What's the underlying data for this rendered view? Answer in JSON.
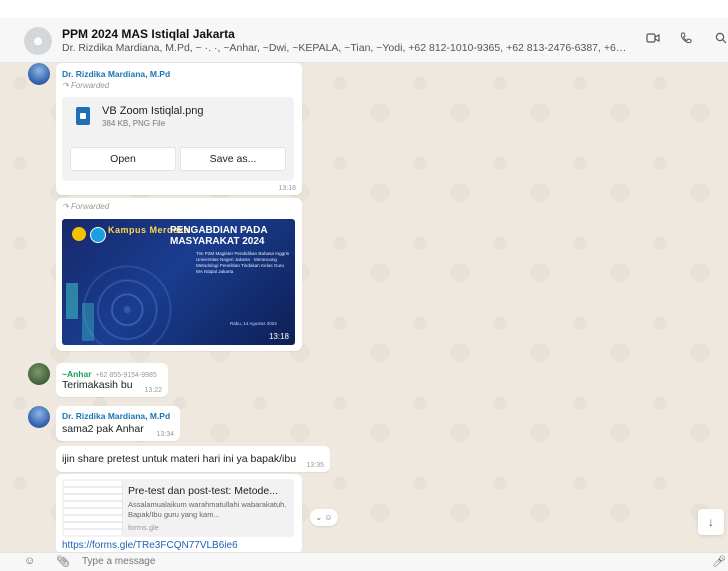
{
  "header": {
    "avatar_icon": "users-group-icon",
    "title": "PPM 2024 MAS Istiqlal Jakarta",
    "subtitle": "Dr. Rizdika Mardiana, M.Pd, ~ ·. ·, ~Anhar, ~Dwi, ~KEPALA, ~Tian, ~Yodi, +62 812-1010-9365, +62 813-2476-6387, +62 8...",
    "video_icon": "video-call-icon",
    "call_icon": "phone-call-icon",
    "search_icon": "search-icon"
  },
  "messages": {
    "m1": {
      "sender": "Dr. Rizdika Mardiana, M.Pd",
      "forwarded": "Forwarded",
      "file_name": "VB Zoom Istiqlal.png",
      "file_meta": "384 KB, PNG File",
      "open_label": "Open",
      "save_label": "Save as...",
      "time": "13:18"
    },
    "m2": {
      "forwarded": "Forwarded",
      "poster_logo": "Kampus Merdeka",
      "poster_title": "PENGABDIAN PADA MASYARAKAT 2024",
      "poster_body": "Tim P2M Magister Pendidikan Bahasa Inggris Universitas Negeri Jakarta · Merancang Metodologi Penelitian Tindakan Kelas Guru MA Istiqlal Jakarta",
      "poster_date": "Rabu, 14 Agustus 2024",
      "time": "13:18"
    },
    "m3": {
      "sender": "~Anhar",
      "phone": "+62 855-9154-9985",
      "text": "Terimakasih bu",
      "time": "13:22"
    },
    "m4": {
      "sender": "Dr. Rizdika Mardiana, M.Pd",
      "text": "sama2 pak Anhar",
      "time": "13:34"
    },
    "m5": {
      "text": "ijin share pretest untuk materi hari ini ya bapak/ibu",
      "time": "13:35"
    },
    "m6": {
      "link_title": "Pre-test dan post-test: Metode...",
      "link_desc": "Assalamualaikum warahmatullahi wabarakatuh. Bapak/Ibu guru yang kam...",
      "link_domain": "forms.gle",
      "url": "https://forms.gle/TRe3FCQN77VLB6ie6"
    }
  },
  "reaction_icon": "emoji-reaction-icon",
  "scroll_down_icon": "arrow-down-icon",
  "composer": {
    "emoji_icon": "emoji-icon",
    "attach_icon": "paperclip-icon",
    "placeholder": "Type a message",
    "mic_icon": "microphone-icon"
  }
}
